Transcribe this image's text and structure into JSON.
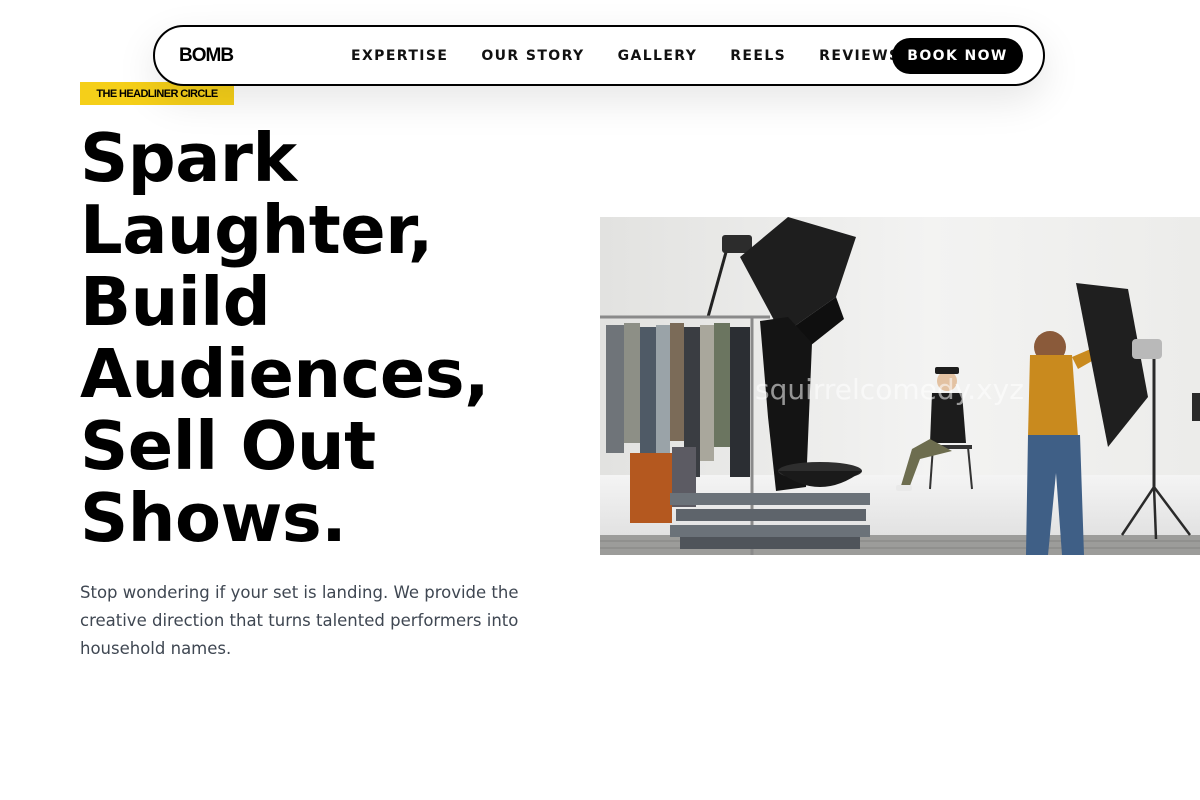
{
  "nav": {
    "logo": "BOMB",
    "links": [
      "EXPERTISE",
      "OUR STORY",
      "GALLERY",
      "REELS",
      "REVIEWS"
    ],
    "cta_label": "BOOK NOW"
  },
  "hero": {
    "badge": "THE HEADLINER CIRCLE",
    "headline_lines": [
      "Spark",
      "Laughter,",
      "Build",
      "Audiences,",
      "Sell Out",
      "Shows."
    ],
    "subtext": "Stop wondering if your set is landing. We provide the creative direction that turns talented performers into household names.",
    "photo_watermark": "squirrelcomedy.xyz"
  },
  "colors": {
    "accent_yellow": "#f5cf19",
    "button_bg": "#000000",
    "text_body": "#3f4752"
  },
  "icons": {
    "photo": "studio-photoshoot-image"
  }
}
